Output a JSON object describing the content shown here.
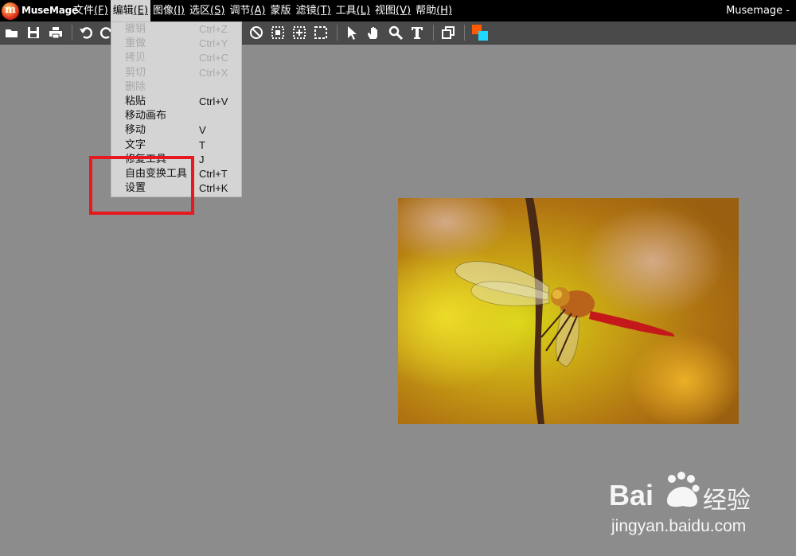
{
  "app": {
    "name": "MuseMage",
    "logo_letter": "m",
    "window_title": "Musemage -"
  },
  "menubar": {
    "items": [
      {
        "label": "文件",
        "key": "(F)",
        "active": false
      },
      {
        "label": "编辑",
        "key": "(E)",
        "active": true
      },
      {
        "label": "图像",
        "key": "(I)",
        "active": false
      },
      {
        "label": "选区",
        "key": "(S)",
        "active": false
      },
      {
        "label": "调节",
        "key": "(A)",
        "active": false
      },
      {
        "label": "蒙版",
        "key": "",
        "active": false
      },
      {
        "label": "滤镜",
        "key": "(T)",
        "active": false
      },
      {
        "label": "工具",
        "key": "(L)",
        "active": false
      },
      {
        "label": "视图",
        "key": "(V)",
        "active": false
      },
      {
        "label": "帮助",
        "key": "(H)",
        "active": false
      }
    ]
  },
  "toolbar": {
    "icons": [
      "open-folder-icon",
      "save-icon",
      "print-icon",
      "undo-icon",
      "redo-icon",
      "no-selection-icon",
      "select-all-icon",
      "transform-select-icon",
      "rect-select-icon",
      "pointer-icon",
      "hand-icon",
      "zoom-icon",
      "text-tool-icon",
      "layers-icon",
      "color-swatch-icon"
    ],
    "colors": {
      "foreground": "#ff5a00",
      "background": "#1fd6ff"
    }
  },
  "edit_menu": {
    "items": [
      {
        "label": "撤销",
        "shortcut": "Ctrl+Z",
        "enabled": false
      },
      {
        "label": "重做",
        "shortcut": "Ctrl+Y",
        "enabled": false
      },
      {
        "label": "拷贝",
        "shortcut": "Ctrl+C",
        "enabled": false
      },
      {
        "label": "剪切",
        "shortcut": "Ctrl+X",
        "enabled": false
      },
      {
        "label": "删除",
        "shortcut": "",
        "enabled": false
      },
      {
        "label": "粘贴",
        "shortcut": "Ctrl+V",
        "enabled": true
      },
      {
        "label": "移动画布",
        "shortcut": "",
        "enabled": true
      },
      {
        "label": "移动",
        "shortcut": "V",
        "enabled": true
      },
      {
        "label": "文字",
        "shortcut": "T",
        "enabled": true
      },
      {
        "label": "修复工具",
        "shortcut": "J",
        "enabled": true
      },
      {
        "label": "自由变换工具",
        "shortcut": "Ctrl+T",
        "enabled": true
      },
      {
        "label": "设置",
        "shortcut": "Ctrl+K",
        "enabled": true
      }
    ]
  },
  "annotation": {
    "color": "#e5191f"
  },
  "watermark": {
    "brand": "Bai",
    "brand_cn": "经验",
    "url": "jingyan.baidu.com"
  }
}
